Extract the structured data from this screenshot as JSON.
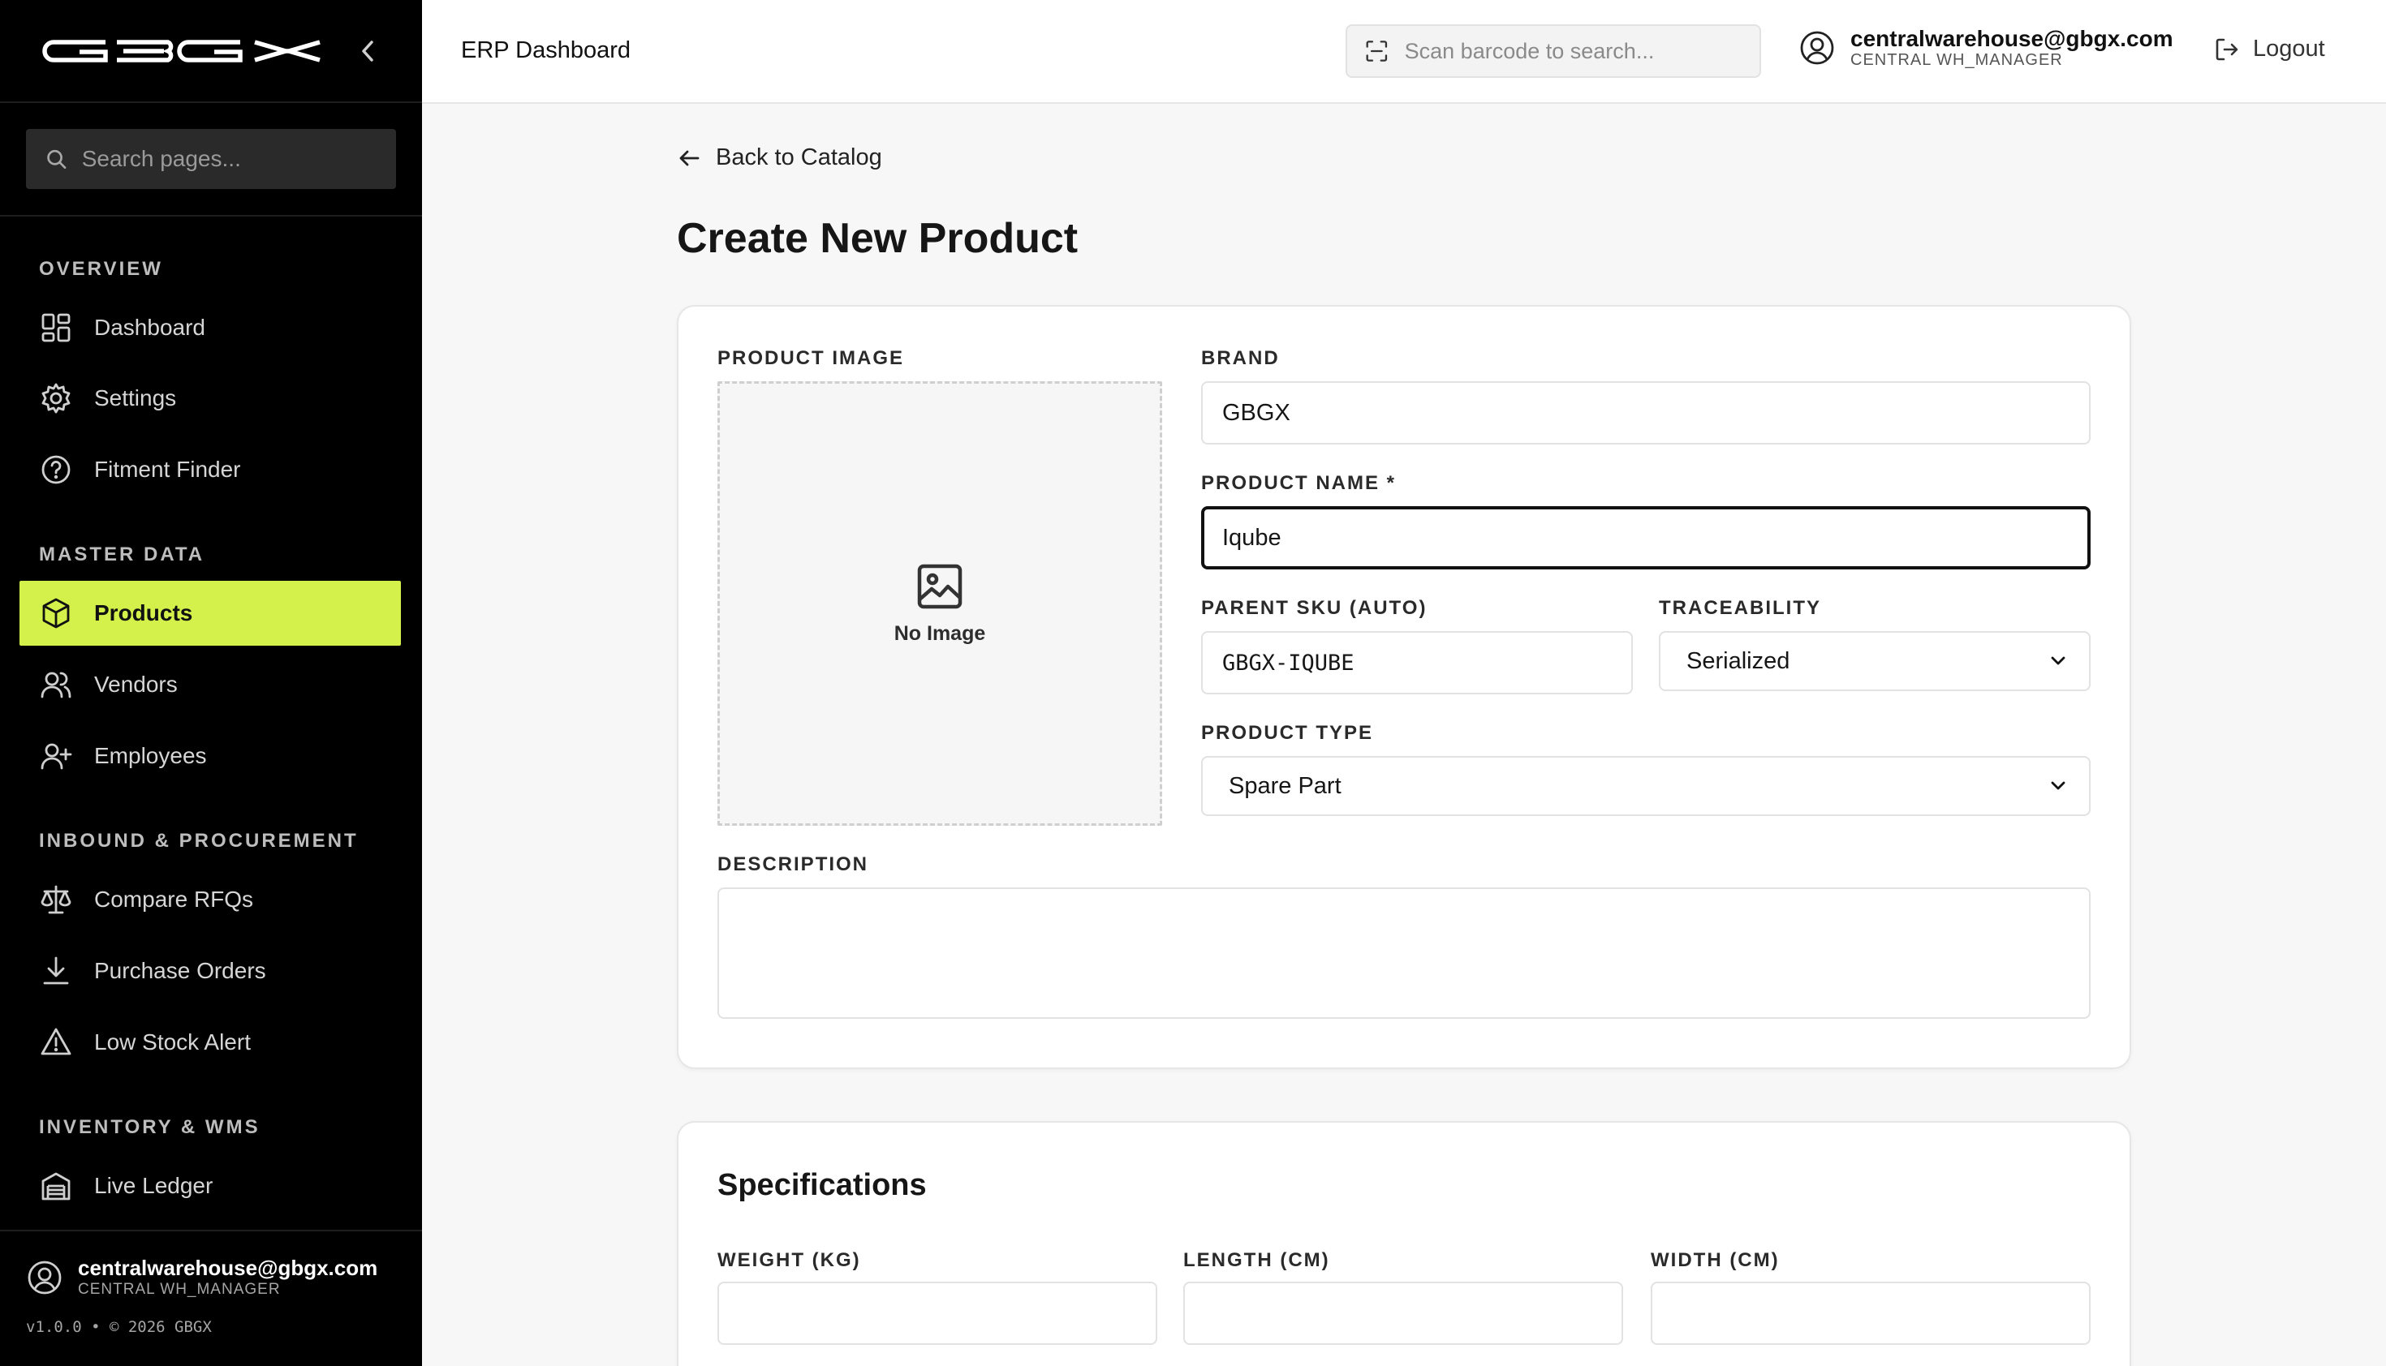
{
  "app": {
    "brand": "GBGX",
    "top_title": "ERP Dashboard"
  },
  "sidebar": {
    "search_placeholder": "Search pages...",
    "sections": [
      {
        "title": "OVERVIEW"
      },
      {
        "title": "MASTER DATA"
      },
      {
        "title": "INBOUND & PROCUREMENT"
      },
      {
        "title": "INVENTORY & WMS"
      }
    ],
    "items": [
      {
        "label": "Dashboard",
        "icon": "grid-icon"
      },
      {
        "label": "Settings",
        "icon": "gear-icon"
      },
      {
        "label": "Fitment Finder",
        "icon": "help-circle-icon"
      },
      {
        "label": "Products",
        "icon": "box-icon",
        "active": true
      },
      {
        "label": "Vendors",
        "icon": "users-icon"
      },
      {
        "label": "Employees",
        "icon": "user-plus-icon"
      },
      {
        "label": "Compare RFQs",
        "icon": "scale-icon"
      },
      {
        "label": "Purchase Orders",
        "icon": "download-icon"
      },
      {
        "label": "Low Stock Alert",
        "icon": "warning-icon"
      },
      {
        "label": "Live Ledger",
        "icon": "warehouse-icon"
      }
    ],
    "user": {
      "email": "centralwarehouse@gbgx.com",
      "role": "CENTRAL WH_MANAGER"
    },
    "version": "v1.0.0 • © 2026 GBGX"
  },
  "topbar": {
    "barcode_placeholder": "Scan barcode to search...",
    "user_email": "centralwarehouse@gbgx.com",
    "user_role": "CENTRAL WH_MANAGER",
    "logout_label": "Logout"
  },
  "main": {
    "back_label": "Back to Catalog",
    "page_title": "Create New Product",
    "form": {
      "image_label": "PRODUCT IMAGE",
      "no_image": "No Image",
      "brand_label": "BRAND",
      "brand_value": "GBGX",
      "name_label": "PRODUCT NAME *",
      "name_value": "Iqube",
      "sku_label": "PARENT SKU (AUTO)",
      "sku_value": "GBGX-IQUBE",
      "traceability_label": "TRACEABILITY",
      "traceability_value": "Serialized",
      "type_label": "PRODUCT TYPE",
      "type_value": "Spare Part",
      "description_label": "DESCRIPTION",
      "description_value": ""
    },
    "specs": {
      "title": "Specifications",
      "weight_label": "WEIGHT (KG)",
      "length_label": "LENGTH (CM)",
      "width_label": "WIDTH (CM)"
    }
  },
  "colors": {
    "sidebar_bg": "#000000",
    "active_item_bg": "#d4f04a",
    "page_bg": "#f7f7f7"
  }
}
